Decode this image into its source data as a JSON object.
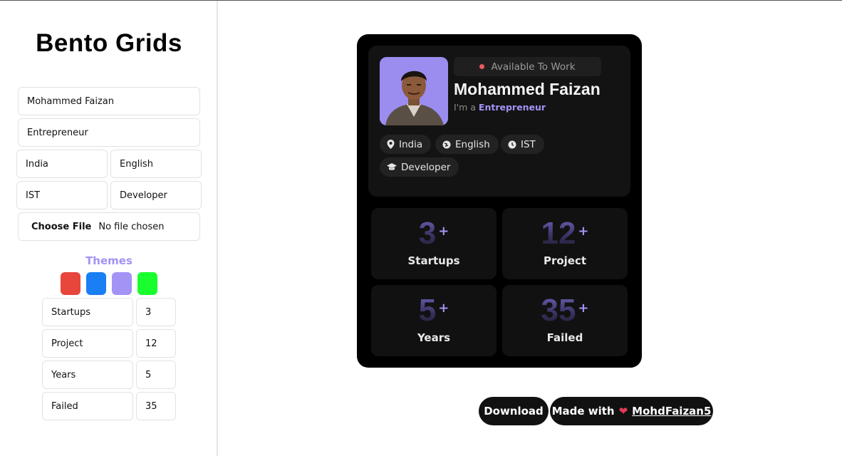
{
  "sidebar": {
    "title": "Bento Grids",
    "name_value": "Mohammed Faizan",
    "role_value": "Entrepreneur",
    "country_value": "India",
    "language_value": "English",
    "timezone_value": "IST",
    "profession_value": "Developer",
    "file_button": "Choose File",
    "file_status": "No file chosen",
    "themes_label": "Themes",
    "theme_colors": [
      "#e8453c",
      "#1a7ef5",
      "#a393f5",
      "#19ff2e"
    ],
    "stats": [
      {
        "label": "Startups",
        "value": "3"
      },
      {
        "label": "Project",
        "value": "12"
      },
      {
        "label": "Years",
        "value": "5"
      },
      {
        "label": "Failed",
        "value": "35"
      }
    ]
  },
  "card": {
    "status": "Available To Work",
    "name": "Mohammed Faizan",
    "role_prefix": "I'm a",
    "role": "Entrepreneur",
    "tags": [
      "India",
      "English",
      "IST",
      "Developer"
    ],
    "plus": "+",
    "stats": [
      {
        "value": "3",
        "label": "Startups"
      },
      {
        "value": "12",
        "label": "Project"
      },
      {
        "value": "5",
        "label": "Years"
      },
      {
        "value": "35",
        "label": "Failed"
      }
    ]
  },
  "actions": {
    "download": "Download",
    "made_with": "Made with",
    "author": "MohdFaizan5"
  },
  "colors": {
    "accent": "#a393f5",
    "card_bg": "#000000",
    "status_dot": "#e85a62"
  }
}
